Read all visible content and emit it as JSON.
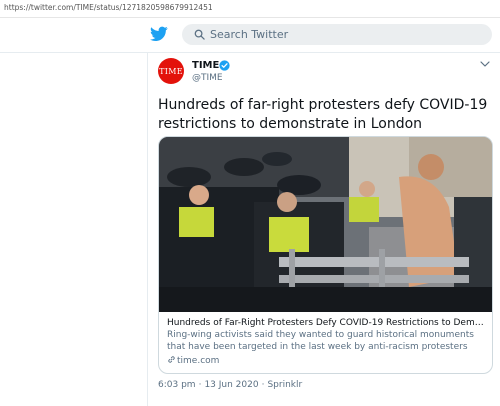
{
  "browser": {
    "url": "https://twitter.com/TIME/status/1271820598679912451"
  },
  "header": {
    "logo_icon": "twitter-bird-icon",
    "search_placeholder": "Search Twitter",
    "brand_color": "#1da1f2"
  },
  "tweet": {
    "avatar_text": "TIME",
    "avatar_color": "#e3120b",
    "display_name": "TIME",
    "handle": "@TIME",
    "verified": true,
    "text": "Hundreds of far-right protesters defy COVID-19 restrictions to demonstrate in London",
    "card": {
      "title": "Hundreds of Far-Right Protesters Defy COVID-19 Restrictions to Demo…",
      "description": "Ring-wing activists said they wanted to guard historical monuments that have been targeted in the last week by anti-racism protesters",
      "domain": "time.com",
      "image_icon": "protest-photo"
    },
    "time": "6:03 pm",
    "separator": "·",
    "date": "13 Jun 2020",
    "source": "Sprinklr"
  }
}
